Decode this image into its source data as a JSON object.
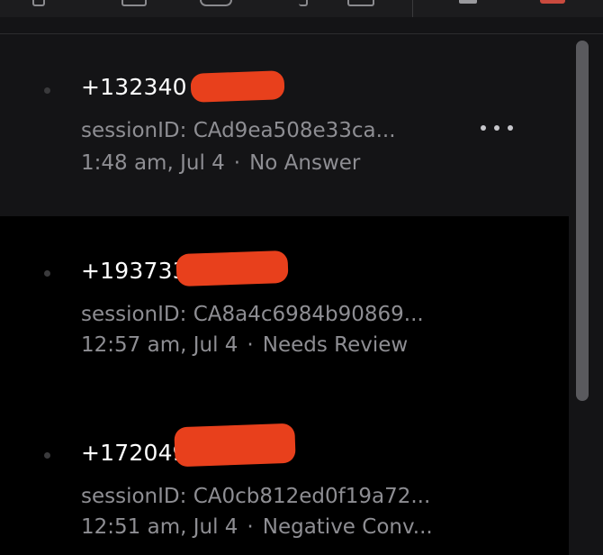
{
  "calls": [
    {
      "phone": "+132340",
      "session": "sessionID: CAd9ea508e33ca...",
      "time": "1:48 am, Jul 4",
      "status": "No Answer",
      "selected": true
    },
    {
      "phone": "+193733",
      "session": "sessionID: CA8a4c6984b90869...",
      "time": "12:57 am, Jul 4",
      "status": "Needs Review",
      "selected": false
    },
    {
      "phone": "+172049",
      "session": "sessionID: CA0cb812ed0f19a72...",
      "time": "12:51 am, Jul 4",
      "status": "Negative Conv...",
      "selected": false
    }
  ],
  "separator": "·",
  "colors": {
    "background": "#000000",
    "selected_row": "#141416",
    "primary_text": "#ffffff",
    "secondary_text": "#8e8e93",
    "redaction": "#e8401c"
  },
  "icons": {
    "more": "more-horizontal-icon",
    "status_dot": "status-dot-icon"
  }
}
